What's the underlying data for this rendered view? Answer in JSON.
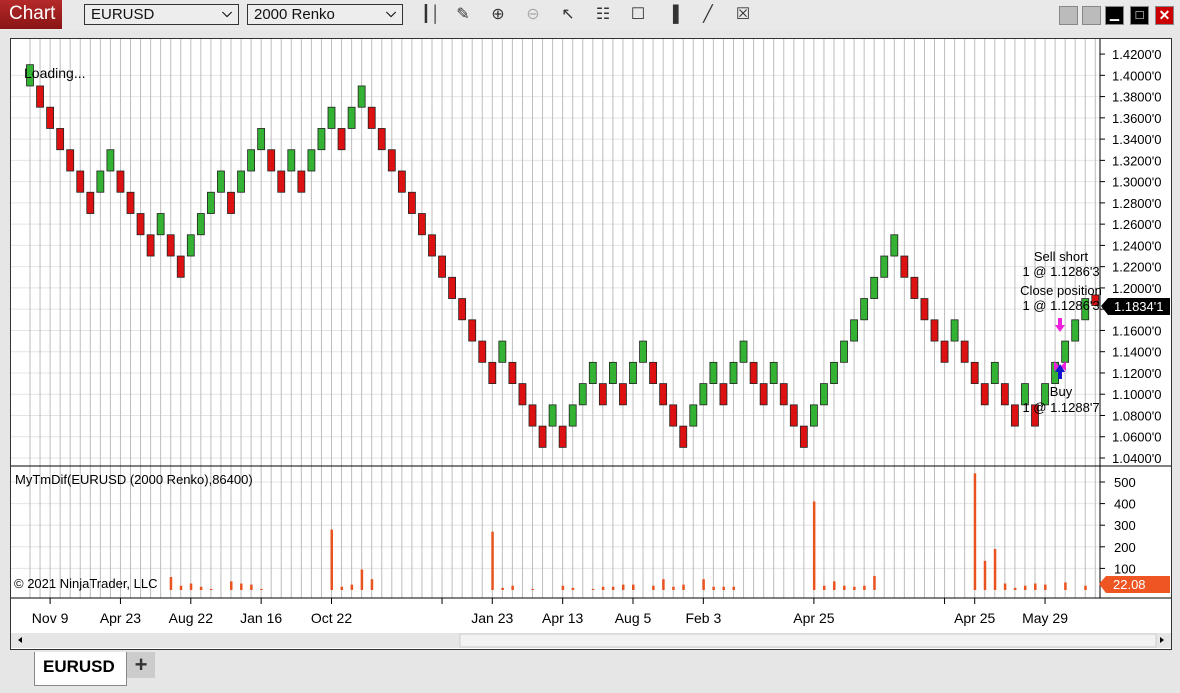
{
  "toolbar": {
    "title": "Chart",
    "instrument": "EURUSD",
    "bar_type": "2000 Renko",
    "icons": [
      "bars-type-icon",
      "drawing-tool-icon",
      "zoom-in-icon",
      "zoom-out-icon",
      "pointer-icon",
      "data-box-icon",
      "properties-icon",
      "strategies-icon",
      "indicators-icon",
      "templates-icon"
    ]
  },
  "window_controls": [
    "tile-button",
    "tile-button-2",
    "minimize-button",
    "maximize-button",
    "close-button"
  ],
  "colors": {
    "up": "#33b233",
    "down": "#dd1111",
    "indicator": "#e8531f",
    "buy_arrow": "#1515cc",
    "sell_arrow": "#ee22dd",
    "price_tag": "#000000",
    "indicator_tag": "#ee5522"
  },
  "price_pane": {
    "loading": "Loading...",
    "current_price": "1.1834'1",
    "y_ticks": [
      "1.4200'0",
      "1.4000'0",
      "1.3800'0",
      "1.3600'0",
      "1.3400'0",
      "1.3200'0",
      "1.3000'0",
      "1.2800'0",
      "1.2600'0",
      "1.2400'0",
      "1.2200'0",
      "1.2000'0",
      "1.1800'0",
      "1.1600'0",
      "1.1400'0",
      "1.1200'0",
      "1.1000'0",
      "1.0800'0",
      "1.0600'0",
      "1.0400'0"
    ],
    "annotations": {
      "sell_short": "Sell short",
      "sell_short_fill": "1 @ 1.1286'3",
      "close_position": "Close position",
      "close_fill": "1 @ 1.1286'3",
      "buy": "Buy",
      "buy_fill": "1 @ 1.1288'7"
    }
  },
  "chart_data": {
    "type": "renko",
    "brick_size": 0.02,
    "ylim": [
      1.04,
      1.42
    ],
    "lows": [
      1.39,
      1.37,
      1.35,
      1.33,
      1.31,
      1.29,
      1.27,
      1.29,
      1.31,
      1.29,
      1.27,
      1.25,
      1.23,
      1.25,
      1.23,
      1.21,
      1.23,
      1.25,
      1.27,
      1.29,
      1.27,
      1.29,
      1.31,
      1.33,
      1.31,
      1.29,
      1.31,
      1.29,
      1.31,
      1.33,
      1.35,
      1.33,
      1.35,
      1.37,
      1.35,
      1.33,
      1.31,
      1.29,
      1.27,
      1.25,
      1.23,
      1.21,
      1.19,
      1.17,
      1.15,
      1.13,
      1.11,
      1.13,
      1.11,
      1.09,
      1.07,
      1.05,
      1.07,
      1.05,
      1.07,
      1.09,
      1.11,
      1.09,
      1.11,
      1.09,
      1.11,
      1.13,
      1.11,
      1.09,
      1.07,
      1.05,
      1.07,
      1.09,
      1.11,
      1.09,
      1.11,
      1.13,
      1.11,
      1.09,
      1.11,
      1.09,
      1.07,
      1.05,
      1.07,
      1.09,
      1.11,
      1.13,
      1.15,
      1.17,
      1.19,
      1.21,
      1.23,
      1.21,
      1.19,
      1.17,
      1.15,
      1.13,
      1.15,
      1.13,
      1.11,
      1.09,
      1.11,
      1.09,
      1.07,
      1.09,
      1.07,
      1.09,
      1.11,
      1.13,
      1.15,
      1.17
    ],
    "dirs": "UDDDDDDUUDDDDUDDUUUUDUUUDDUDUUUDUUDDDDDDDDDDDDDUDDDDUDUUUDUDUUDDDDUUUDUUDDUDDDUUUUUUUUUDDDDDUDDDUDDUDUUUUU",
    "last_brick": {
      "low": 1.1834,
      "high": 1.1934,
      "dir": "D"
    },
    "x_labels": [
      {
        "i": 2,
        "t": "Nov 9"
      },
      {
        "i": 9,
        "t": "Apr 23"
      },
      {
        "i": 16,
        "t": "Aug 22"
      },
      {
        "i": 23,
        "t": "Jan 16"
      },
      {
        "i": 30,
        "t": "Oct 22"
      },
      {
        "i": 41,
        "t": ""
      },
      {
        "i": 46,
        "t": "Jan 23"
      },
      {
        "i": 53,
        "t": "Apr 13"
      },
      {
        "i": 60,
        "t": "Aug 5"
      },
      {
        "i": 67,
        "t": "Feb 3"
      },
      {
        "i": 78,
        "t": "Apr 25"
      },
      {
        "i": 91,
        "t": ""
      },
      {
        "i": 94,
        "t": "Apr 25"
      },
      {
        "i": 101,
        "t": "May 29"
      }
    ],
    "executions": [
      {
        "i": 102,
        "type": "buy",
        "price": 1.12887
      },
      {
        "i": 102,
        "type": "close",
        "price": 1.12863
      },
      {
        "i": 102,
        "type": "sell_short",
        "price": 1.16
      }
    ]
  },
  "indicator": {
    "label": "MyTmDif(EURUSD (2000 Renko),86400)",
    "current": "22.08",
    "copyright": "© 2021 NinjaTrader, LLC",
    "y_ticks": [
      "500",
      "400",
      "300",
      "200",
      "100"
    ],
    "ylim": [
      0,
      550
    ],
    "values": [
      0,
      0,
      0,
      0,
      0,
      0,
      0,
      0,
      0,
      0,
      0,
      0,
      0,
      0,
      60,
      20,
      30,
      15,
      5,
      0,
      40,
      30,
      25,
      5,
      0,
      0,
      0,
      0,
      0,
      0,
      280,
      15,
      25,
      95,
      50,
      0,
      0,
      0,
      0,
      0,
      0,
      0,
      0,
      0,
      0,
      0,
      270,
      10,
      20,
      0,
      5,
      0,
      0,
      20,
      10,
      0,
      5,
      15,
      15,
      25,
      25,
      0,
      20,
      50,
      15,
      25,
      0,
      50,
      15,
      15,
      15,
      0,
      0,
      0,
      0,
      0,
      0,
      0,
      410,
      20,
      40,
      20,
      15,
      20,
      65,
      0,
      0,
      0,
      0,
      0,
      0,
      0,
      0,
      0,
      540,
      135,
      190,
      30,
      10,
      20,
      30,
      25,
      0,
      35,
      0,
      20
    ]
  },
  "tabs": [
    {
      "label": "EURUSD"
    }
  ],
  "add_tab": "+"
}
